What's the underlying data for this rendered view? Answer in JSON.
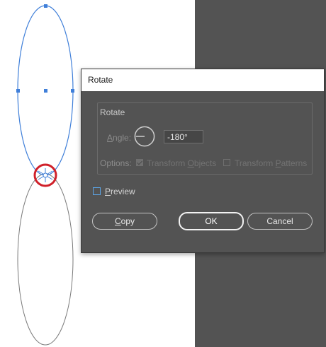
{
  "dialog": {
    "title": "Rotate",
    "group_label": "Rotate",
    "angle_label_accel": "A",
    "angle_label_rest": "ngle:",
    "angle_value": "-180°",
    "options_label": "Options:",
    "transform_objects": {
      "label_pre": "Transform ",
      "label_accel": "O",
      "label_post": "bjects",
      "checked": true
    },
    "transform_patterns": {
      "label_pre": "Transform ",
      "label_accel": "P",
      "label_post": "atterns",
      "checked": false
    },
    "preview": {
      "label_accel": "P",
      "label_rest": "review",
      "checked": false
    },
    "buttons": {
      "copy_accel": "C",
      "copy_rest": "opy",
      "ok": "OK",
      "cancel": "Cancel"
    }
  },
  "colors": {
    "selection_blue": "#3f7fd9",
    "reference_point_red": "#d0202a",
    "pasteboard": "#535353"
  }
}
